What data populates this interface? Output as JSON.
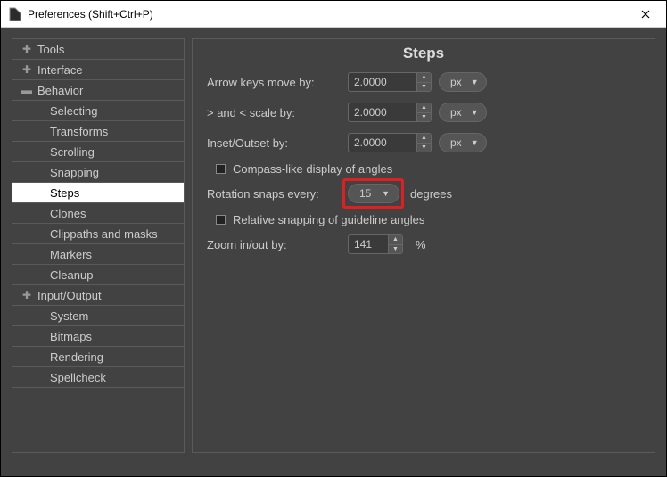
{
  "window": {
    "title": "Preferences (Shift+Ctrl+P)"
  },
  "sidebar": {
    "items": [
      {
        "label": "Tools",
        "level": 1,
        "expander": "plus"
      },
      {
        "label": "Interface",
        "level": 1,
        "expander": "plus"
      },
      {
        "label": "Behavior",
        "level": 1,
        "expander": "minus"
      },
      {
        "label": "Selecting",
        "level": 2
      },
      {
        "label": "Transforms",
        "level": 2
      },
      {
        "label": "Scrolling",
        "level": 2
      },
      {
        "label": "Snapping",
        "level": 2
      },
      {
        "label": "Steps",
        "level": 2,
        "selected": true
      },
      {
        "label": "Clones",
        "level": 2
      },
      {
        "label": "Clippaths and masks",
        "level": 2
      },
      {
        "label": "Markers",
        "level": 2
      },
      {
        "label": "Cleanup",
        "level": 2
      },
      {
        "label": "Input/Output",
        "level": 1,
        "expander": "plus"
      },
      {
        "label": "System",
        "level": 2
      },
      {
        "label": "Bitmaps",
        "level": 2
      },
      {
        "label": "Rendering",
        "level": 2
      },
      {
        "label": "Spellcheck",
        "level": 2
      }
    ]
  },
  "main": {
    "header": "Steps",
    "arrow_label": "Arrow keys move by:",
    "arrow_value": "2.0000",
    "arrow_unit": "px",
    "scale_label": "> and < scale by:",
    "scale_value": "2.0000",
    "scale_unit": "px",
    "inset_label": "Inset/Outset by:",
    "inset_value": "2.0000",
    "inset_unit": "px",
    "compass_label": "Compass-like display of angles",
    "rotation_label": "Rotation snaps every:",
    "rotation_value": "15",
    "rotation_suffix": "degrees",
    "relative_label": "Relative snapping of guideline angles",
    "zoom_label": "Zoom in/out by:",
    "zoom_value": "141",
    "zoom_suffix": "%"
  }
}
